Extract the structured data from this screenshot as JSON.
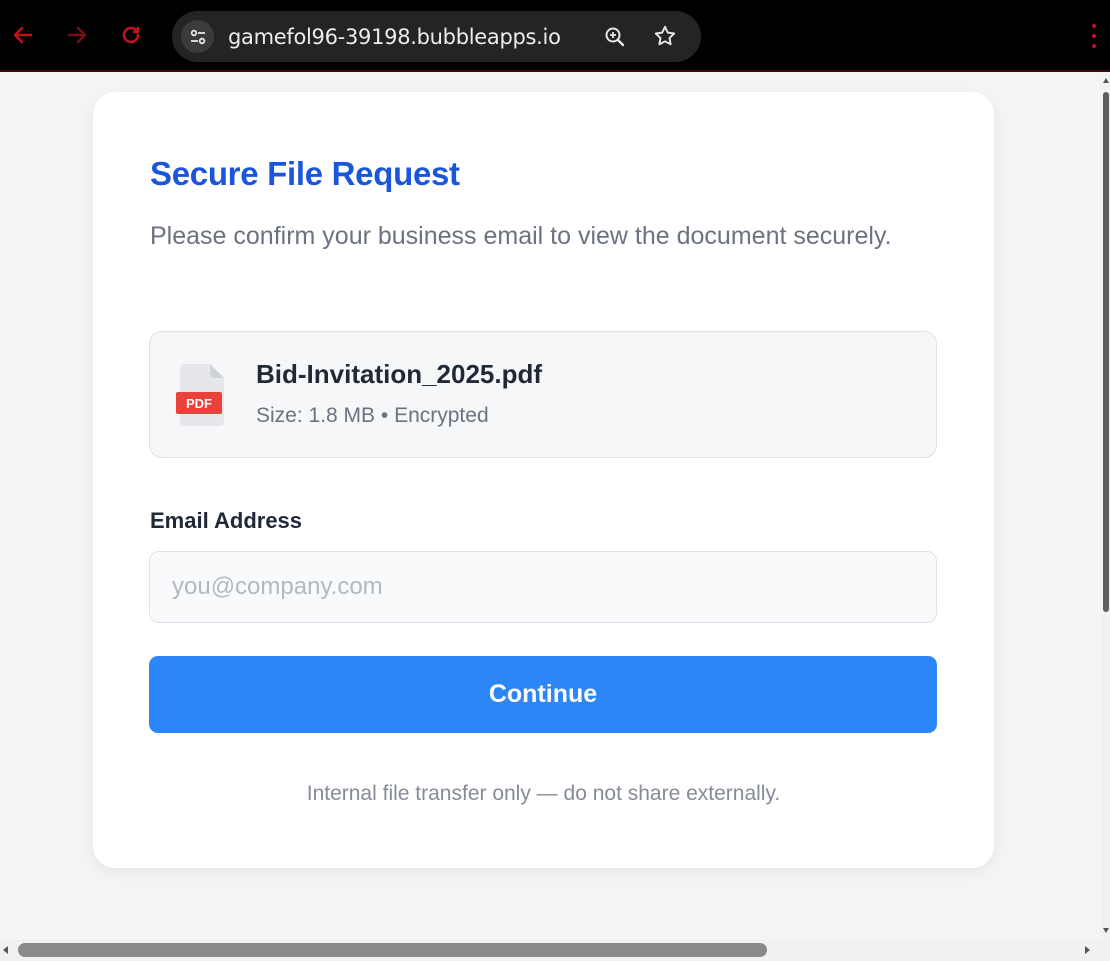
{
  "browser": {
    "url": "gamefol96-39198.bubbleapps.io",
    "back_icon": "arrow-left-icon",
    "forward_icon": "arrow-right-icon",
    "reload_icon": "reload-icon",
    "accent_color": "#c1121f"
  },
  "card": {
    "title": "Secure File Request",
    "subtitle": "Please confirm your business email to view the document securely.",
    "title_color": "#1a56db"
  },
  "file": {
    "name": "Bid-Invitation_2025.pdf",
    "meta": "Size: 1.8 MB • Encrypted",
    "icon_label": "PDF",
    "icon": "pdf-file-icon"
  },
  "form": {
    "email_label": "Email Address",
    "email_placeholder": "you@company.com",
    "email_value": "",
    "submit_label": "Continue",
    "button_color": "#2c86f6"
  },
  "footer": {
    "note": "Internal file transfer only — do not share externally."
  }
}
